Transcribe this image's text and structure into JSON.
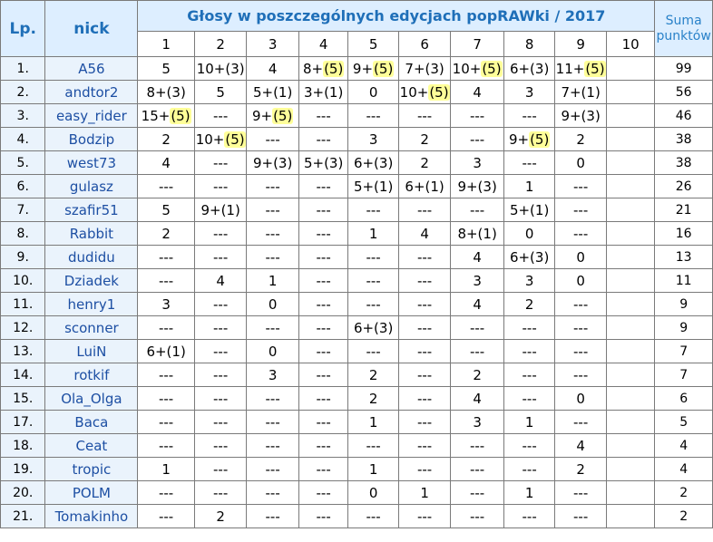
{
  "headers": {
    "lp": "Lp.",
    "nick": "nick",
    "title": "Głosy w poszczególnych edycjach popRAWki / 2017",
    "suma_line1": "Suma",
    "suma_line2": "punktów",
    "editions": [
      "1",
      "2",
      "3",
      "4",
      "5",
      "6",
      "7",
      "8",
      "9",
      "10"
    ]
  },
  "colors": {
    "header_text": "#1f6fb8",
    "header_bg": "#ddeeff",
    "bonus_highlight": "#ffff99"
  },
  "rows": [
    {
      "lp": "1.",
      "nick": "A56",
      "cells": [
        [
          "5",
          ""
        ],
        [
          "10+(3)",
          ""
        ],
        [
          "4",
          ""
        ],
        [
          "8+",
          "(5)"
        ],
        [
          "9+",
          "(5)"
        ],
        [
          "7+(3)",
          ""
        ],
        [
          "10+",
          "(5)"
        ],
        [
          "6+(3)",
          ""
        ],
        [
          "11+",
          "(5)"
        ],
        [
          "",
          ""
        ]
      ],
      "sum": "99"
    },
    {
      "lp": "2.",
      "nick": "andtor2",
      "cells": [
        [
          "8+(3)",
          ""
        ],
        [
          "5",
          ""
        ],
        [
          "5+(1)",
          ""
        ],
        [
          "3+(1)",
          ""
        ],
        [
          "0",
          ""
        ],
        [
          "10+",
          "(5)"
        ],
        [
          "4",
          ""
        ],
        [
          "3",
          ""
        ],
        [
          "7+(1)",
          ""
        ],
        [
          "",
          ""
        ]
      ],
      "sum": "56"
    },
    {
      "lp": "3.",
      "nick": "easy_rider",
      "cells": [
        [
          "15+",
          "(5)"
        ],
        [
          "---",
          ""
        ],
        [
          "9+",
          "(5)"
        ],
        [
          "---",
          ""
        ],
        [
          "---",
          ""
        ],
        [
          "---",
          ""
        ],
        [
          "---",
          ""
        ],
        [
          "---",
          ""
        ],
        [
          "9+(3)",
          ""
        ],
        [
          "",
          ""
        ]
      ],
      "sum": "46"
    },
    {
      "lp": "4.",
      "nick": "Bodzip",
      "cells": [
        [
          "2",
          ""
        ],
        [
          "10+",
          "(5)"
        ],
        [
          "---",
          ""
        ],
        [
          "---",
          ""
        ],
        [
          "3",
          ""
        ],
        [
          "2",
          ""
        ],
        [
          "---",
          ""
        ],
        [
          "9+",
          "(5)"
        ],
        [
          "2",
          ""
        ],
        [
          "",
          ""
        ]
      ],
      "sum": "38"
    },
    {
      "lp": "5.",
      "nick": "west73",
      "cells": [
        [
          "4",
          ""
        ],
        [
          "---",
          ""
        ],
        [
          "9+(3)",
          ""
        ],
        [
          "5+(3)",
          ""
        ],
        [
          "6+(3)",
          ""
        ],
        [
          "2",
          ""
        ],
        [
          "3",
          ""
        ],
        [
          "---",
          ""
        ],
        [
          "0",
          ""
        ],
        [
          "",
          ""
        ]
      ],
      "sum": "38"
    },
    {
      "lp": "6.",
      "nick": "gulasz",
      "cells": [
        [
          "---",
          ""
        ],
        [
          "---",
          ""
        ],
        [
          "---",
          ""
        ],
        [
          "---",
          ""
        ],
        [
          "5+(1)",
          ""
        ],
        [
          "6+(1)",
          ""
        ],
        [
          "9+(3)",
          ""
        ],
        [
          "1",
          ""
        ],
        [
          "---",
          ""
        ],
        [
          "",
          ""
        ]
      ],
      "sum": "26"
    },
    {
      "lp": "7.",
      "nick": "szafir51",
      "cells": [
        [
          "5",
          ""
        ],
        [
          "9+(1)",
          ""
        ],
        [
          "---",
          ""
        ],
        [
          "---",
          ""
        ],
        [
          "---",
          ""
        ],
        [
          "---",
          ""
        ],
        [
          "---",
          ""
        ],
        [
          "5+(1)",
          ""
        ],
        [
          "---",
          ""
        ],
        [
          "",
          ""
        ]
      ],
      "sum": "21"
    },
    {
      "lp": "8.",
      "nick": "Rabbit",
      "cells": [
        [
          "2",
          ""
        ],
        [
          "---",
          ""
        ],
        [
          "---",
          ""
        ],
        [
          "---",
          ""
        ],
        [
          "1",
          ""
        ],
        [
          "4",
          ""
        ],
        [
          "8+(1)",
          ""
        ],
        [
          "0",
          ""
        ],
        [
          "---",
          ""
        ],
        [
          "",
          ""
        ]
      ],
      "sum": "16"
    },
    {
      "lp": "9.",
      "nick": "dudidu",
      "cells": [
        [
          "---",
          ""
        ],
        [
          "---",
          ""
        ],
        [
          "---",
          ""
        ],
        [
          "---",
          ""
        ],
        [
          "---",
          ""
        ],
        [
          "---",
          ""
        ],
        [
          "4",
          ""
        ],
        [
          "6+(3)",
          ""
        ],
        [
          "0",
          ""
        ],
        [
          "",
          ""
        ]
      ],
      "sum": "13"
    },
    {
      "lp": "10.",
      "nick": "Dziadek",
      "cells": [
        [
          "---",
          ""
        ],
        [
          "4",
          ""
        ],
        [
          "1",
          ""
        ],
        [
          "---",
          ""
        ],
        [
          "---",
          ""
        ],
        [
          "---",
          ""
        ],
        [
          "3",
          ""
        ],
        [
          "3",
          ""
        ],
        [
          "0",
          ""
        ],
        [
          "",
          ""
        ]
      ],
      "sum": "11"
    },
    {
      "lp": "11.",
      "nick": "henry1",
      "cells": [
        [
          "3",
          ""
        ],
        [
          "---",
          ""
        ],
        [
          "0",
          ""
        ],
        [
          "---",
          ""
        ],
        [
          "---",
          ""
        ],
        [
          "---",
          ""
        ],
        [
          "4",
          ""
        ],
        [
          "2",
          ""
        ],
        [
          "---",
          ""
        ],
        [
          "",
          ""
        ]
      ],
      "sum": "9"
    },
    {
      "lp": "12.",
      "nick": "sconner",
      "cells": [
        [
          "---",
          ""
        ],
        [
          "---",
          ""
        ],
        [
          "---",
          ""
        ],
        [
          "---",
          ""
        ],
        [
          "6+(3)",
          ""
        ],
        [
          "---",
          ""
        ],
        [
          "---",
          ""
        ],
        [
          "---",
          ""
        ],
        [
          "---",
          ""
        ],
        [
          "",
          ""
        ]
      ],
      "sum": "9"
    },
    {
      "lp": "13.",
      "nick": "LuiN",
      "cells": [
        [
          "6+(1)",
          ""
        ],
        [
          "---",
          ""
        ],
        [
          "0",
          ""
        ],
        [
          "---",
          ""
        ],
        [
          "---",
          ""
        ],
        [
          "---",
          ""
        ],
        [
          "---",
          ""
        ],
        [
          "---",
          ""
        ],
        [
          "---",
          ""
        ],
        [
          "",
          ""
        ]
      ],
      "sum": "7"
    },
    {
      "lp": "14.",
      "nick": "rotkif",
      "cells": [
        [
          "---",
          ""
        ],
        [
          "---",
          ""
        ],
        [
          "3",
          ""
        ],
        [
          "---",
          ""
        ],
        [
          "2",
          ""
        ],
        [
          "---",
          ""
        ],
        [
          "2",
          ""
        ],
        [
          "---",
          ""
        ],
        [
          "---",
          ""
        ],
        [
          "",
          ""
        ]
      ],
      "sum": "7"
    },
    {
      "lp": "15.",
      "nick": "Ola_Olga",
      "cells": [
        [
          "---",
          ""
        ],
        [
          "---",
          ""
        ],
        [
          "---",
          ""
        ],
        [
          "---",
          ""
        ],
        [
          "2",
          ""
        ],
        [
          "---",
          ""
        ],
        [
          "4",
          ""
        ],
        [
          "---",
          ""
        ],
        [
          "0",
          ""
        ],
        [
          "",
          ""
        ]
      ],
      "sum": "6"
    },
    {
      "lp": "17.",
      "nick": "Baca",
      "cells": [
        [
          "---",
          ""
        ],
        [
          "---",
          ""
        ],
        [
          "---",
          ""
        ],
        [
          "---",
          ""
        ],
        [
          "1",
          ""
        ],
        [
          "---",
          ""
        ],
        [
          "3",
          ""
        ],
        [
          "1",
          ""
        ],
        [
          "---",
          ""
        ],
        [
          "",
          ""
        ]
      ],
      "sum": "5"
    },
    {
      "lp": "18.",
      "nick": "Ceat",
      "cells": [
        [
          "---",
          ""
        ],
        [
          "---",
          ""
        ],
        [
          "---",
          ""
        ],
        [
          "---",
          ""
        ],
        [
          "---",
          ""
        ],
        [
          "---",
          ""
        ],
        [
          "---",
          ""
        ],
        [
          "---",
          ""
        ],
        [
          "4",
          ""
        ],
        [
          "",
          ""
        ]
      ],
      "sum": "4"
    },
    {
      "lp": "19.",
      "nick": "tropic",
      "cells": [
        [
          "1",
          ""
        ],
        [
          "---",
          ""
        ],
        [
          "---",
          ""
        ],
        [
          "---",
          ""
        ],
        [
          "1",
          ""
        ],
        [
          "---",
          ""
        ],
        [
          "---",
          ""
        ],
        [
          "---",
          ""
        ],
        [
          "2",
          ""
        ],
        [
          "",
          ""
        ]
      ],
      "sum": "4"
    },
    {
      "lp": "20.",
      "nick": "POLM",
      "cells": [
        [
          "---",
          ""
        ],
        [
          "---",
          ""
        ],
        [
          "---",
          ""
        ],
        [
          "---",
          ""
        ],
        [
          "0",
          ""
        ],
        [
          "1",
          ""
        ],
        [
          "---",
          ""
        ],
        [
          "1",
          ""
        ],
        [
          "---",
          ""
        ],
        [
          "",
          ""
        ]
      ],
      "sum": "2"
    },
    {
      "lp": "21.",
      "nick": "Tomakinho",
      "cells": [
        [
          "---",
          ""
        ],
        [
          "2",
          ""
        ],
        [
          "---",
          ""
        ],
        [
          "---",
          ""
        ],
        [
          "---",
          ""
        ],
        [
          "---",
          ""
        ],
        [
          "---",
          ""
        ],
        [
          "---",
          ""
        ],
        [
          "---",
          ""
        ],
        [
          "",
          ""
        ]
      ],
      "sum": "2"
    }
  ]
}
